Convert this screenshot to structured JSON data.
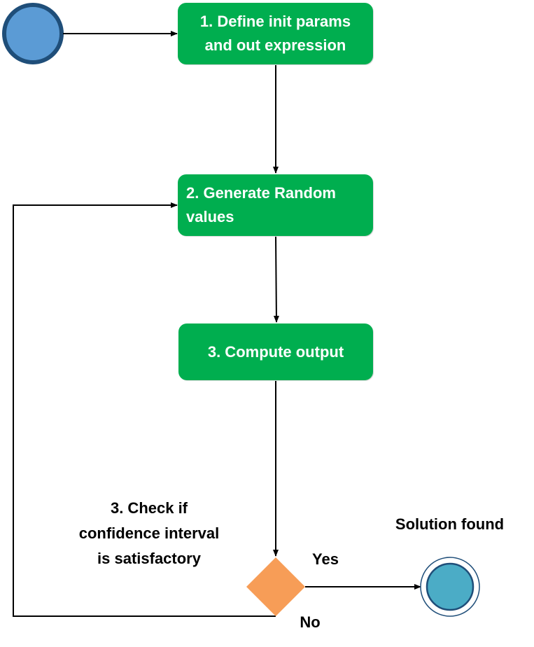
{
  "nodes": {
    "define": "1. Define  init params\nand out expression",
    "generate": "2. Generate  Random\n     values",
    "compute": "3. Compute output"
  },
  "labels": {
    "check": "3. Check if\nconfidence interval\nis satisfactory",
    "solution": "Solution found",
    "yes": "Yes",
    "no": "No"
  },
  "colors": {
    "process_fill": "#00ae4f",
    "start_fill": "#5b9bd5",
    "start_stroke": "#1f4e79",
    "end_fill": "#4bacc6",
    "decision_fill": "#f79d57",
    "connector": "#000000"
  }
}
